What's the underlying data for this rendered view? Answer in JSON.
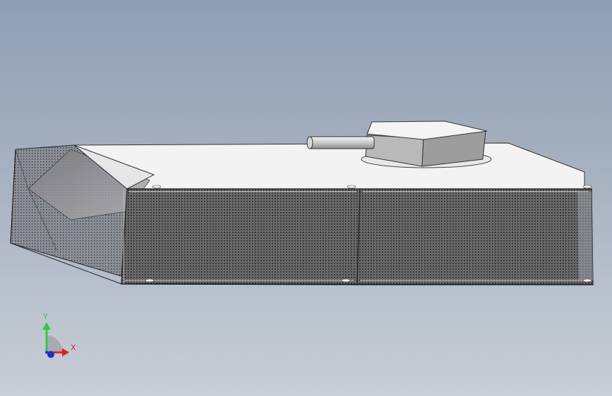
{
  "viewport": {
    "background_top": "#8f9fb2",
    "background_bottom": "#c8ced7",
    "model_name": "tank-model",
    "mesh_color": "#4f4f4f",
    "armor_top_color": "#f2f2f2"
  },
  "triad": {
    "y_label": "Y",
    "x_label": "X",
    "y_color": "#2ecc40",
    "x_color": "#e02020",
    "z_color": "#2030c0"
  }
}
